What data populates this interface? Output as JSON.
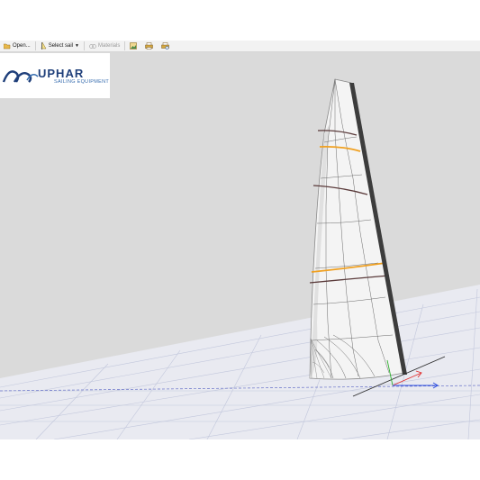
{
  "toolbar": {
    "open_label": "Open...",
    "select_sail_label": "Select sail",
    "materials_label": "Materials"
  },
  "logo": {
    "brand": "UPHAR",
    "tagline": "SAILING EQUIPMENT"
  },
  "colors": {
    "viewport_bg": "#dadada",
    "grid_line": "#b9bfd6",
    "sail_fill": "#f4f4f4",
    "batten_orange": "#f0a020",
    "batten_dark": "#5a3a3a",
    "mast": "#3c3c3c",
    "axis_red": "#e03030",
    "axis_green": "#30b030",
    "axis_blue": "#3050e0"
  },
  "icons": {
    "open": "folder-open-icon",
    "select_sail": "sail-icon",
    "materials": "materials-icon",
    "tool1": "image-icon",
    "tool2": "print-icon",
    "tool3": "print-preview-icon"
  }
}
